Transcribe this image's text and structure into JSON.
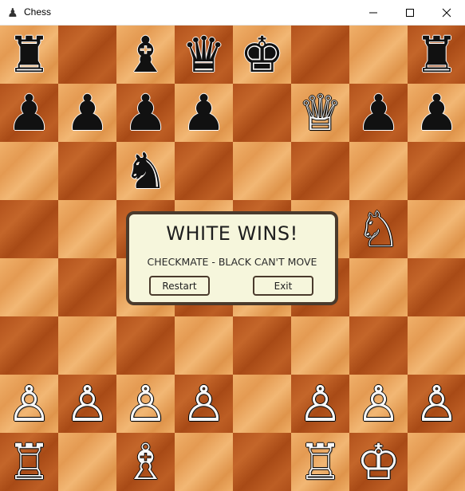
{
  "window": {
    "title": "Chess",
    "app_icon": "chess-pawn-icon",
    "controls": [
      "minimize-icon",
      "maximize-icon",
      "close-icon"
    ]
  },
  "colors": {
    "light_square": "#e9a35c",
    "dark_square": "#b5561e",
    "dialog_bg": "#f6f6dc",
    "dialog_border": "#4a3a2c"
  },
  "board": {
    "pieces": [
      {
        "square": "a8",
        "type": "rook",
        "color": "black",
        "glyph": "♜"
      },
      {
        "square": "c8",
        "type": "bishop",
        "color": "black",
        "glyph": "♝"
      },
      {
        "square": "d8",
        "type": "queen",
        "color": "black",
        "glyph": "♛"
      },
      {
        "square": "e8",
        "type": "king",
        "color": "black",
        "glyph": "♚"
      },
      {
        "square": "h8",
        "type": "rook",
        "color": "black",
        "glyph": "♜"
      },
      {
        "square": "a7",
        "type": "pawn",
        "color": "black",
        "glyph": "♟"
      },
      {
        "square": "b7",
        "type": "pawn",
        "color": "black",
        "glyph": "♟"
      },
      {
        "square": "c7",
        "type": "pawn",
        "color": "black",
        "glyph": "♟"
      },
      {
        "square": "d7",
        "type": "pawn",
        "color": "black",
        "glyph": "♟"
      },
      {
        "square": "f7",
        "type": "queen",
        "color": "white",
        "glyph": "♕"
      },
      {
        "square": "g7",
        "type": "pawn",
        "color": "black",
        "glyph": "♟"
      },
      {
        "square": "h7",
        "type": "pawn",
        "color": "black",
        "glyph": "♟"
      },
      {
        "square": "c6",
        "type": "knight",
        "color": "black",
        "glyph": "♞"
      },
      {
        "square": "g5",
        "type": "knight",
        "color": "white",
        "glyph": "♘"
      },
      {
        "square": "a2",
        "type": "pawn",
        "color": "white",
        "glyph": "♙"
      },
      {
        "square": "b2",
        "type": "pawn",
        "color": "white",
        "glyph": "♙"
      },
      {
        "square": "c2",
        "type": "pawn",
        "color": "white",
        "glyph": "♙"
      },
      {
        "square": "d2",
        "type": "pawn",
        "color": "white",
        "glyph": "♙"
      },
      {
        "square": "f2",
        "type": "pawn",
        "color": "white",
        "glyph": "♙"
      },
      {
        "square": "g2",
        "type": "pawn",
        "color": "white",
        "glyph": "♙"
      },
      {
        "square": "h2",
        "type": "pawn",
        "color": "white",
        "glyph": "♙"
      },
      {
        "square": "a1",
        "type": "rook",
        "color": "white",
        "glyph": "♖"
      },
      {
        "square": "c1",
        "type": "bishop",
        "color": "white",
        "glyph": "♗"
      },
      {
        "square": "f1",
        "type": "rook",
        "color": "white",
        "glyph": "♖"
      },
      {
        "square": "g1",
        "type": "king",
        "color": "white",
        "glyph": "♔"
      }
    ]
  },
  "dialog": {
    "title": "WHITE WINS!",
    "message": "CHECKMATE - BLACK CAN'T MOVE",
    "restart_label": "Restart",
    "exit_label": "Exit"
  }
}
